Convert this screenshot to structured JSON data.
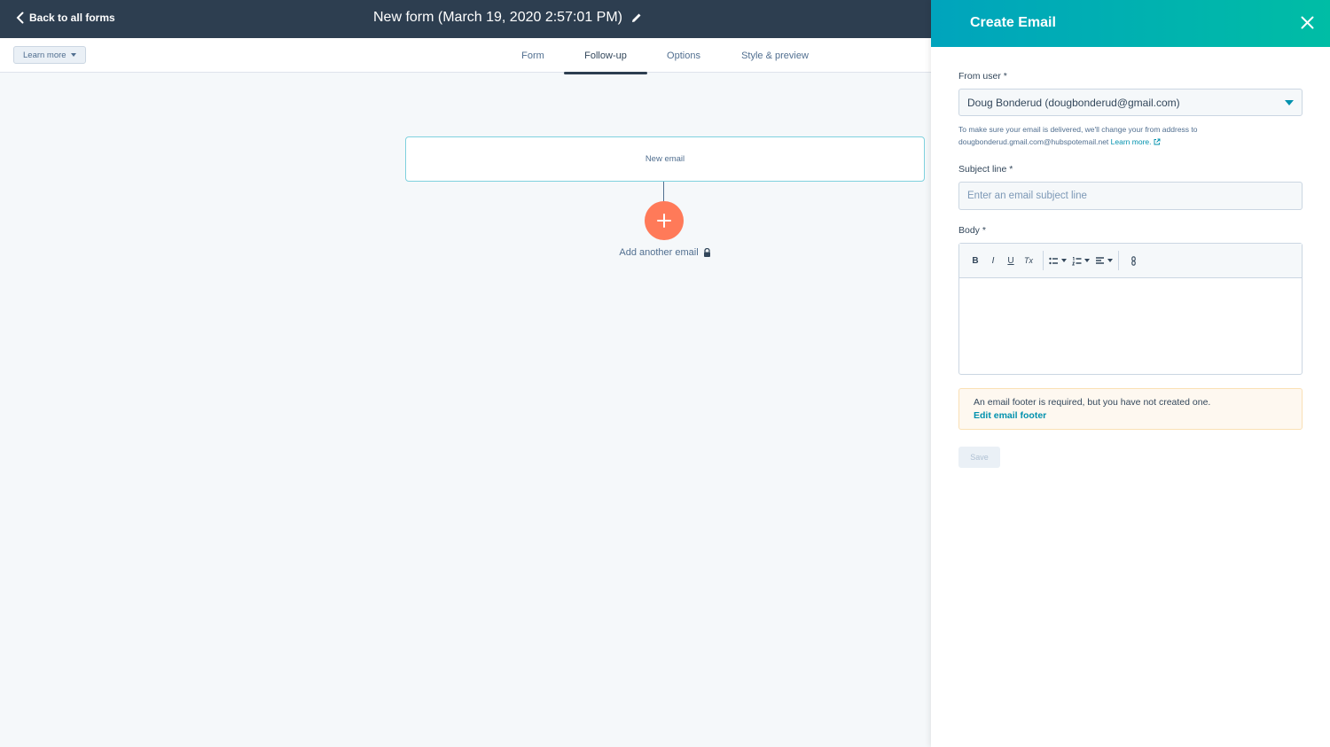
{
  "topbar": {
    "back_label": "Back to all forms",
    "title": "New form (March 19, 2020 2:57:01 PM)"
  },
  "tabsbar": {
    "learn_more": "Learn more",
    "tabs": [
      {
        "label": "Form"
      },
      {
        "label": "Follow-up"
      },
      {
        "label": "Options"
      },
      {
        "label": "Style & preview"
      }
    ],
    "active_tab": "Follow-up"
  },
  "canvas": {
    "email_card": "New email",
    "add_label": "Add another email"
  },
  "panel": {
    "title": "Create Email",
    "from_user": {
      "label": "From user *",
      "value": "Doug Bonderud (dougbonderud@gmail.com)",
      "help_text": "To make sure your email is delivered, we'll change your from address to dougbonderud.gmail.com@hubspotemail.net",
      "help_link": "Learn more."
    },
    "subject": {
      "label": "Subject line *",
      "placeholder": "Enter an email subject line"
    },
    "body": {
      "label": "Body *",
      "toolbar": {
        "bold": "B",
        "italic": "I",
        "underline": "U",
        "clear": "Tx"
      }
    },
    "alert": {
      "text": "An email footer is required, but you have not created one.",
      "link": "Edit email footer"
    },
    "save_label": "Save"
  },
  "colors": {
    "topbar": "#2d3e50",
    "accent_teal": "#00a4bd",
    "accent_orange": "#ff7a59",
    "link": "#0091ae"
  }
}
